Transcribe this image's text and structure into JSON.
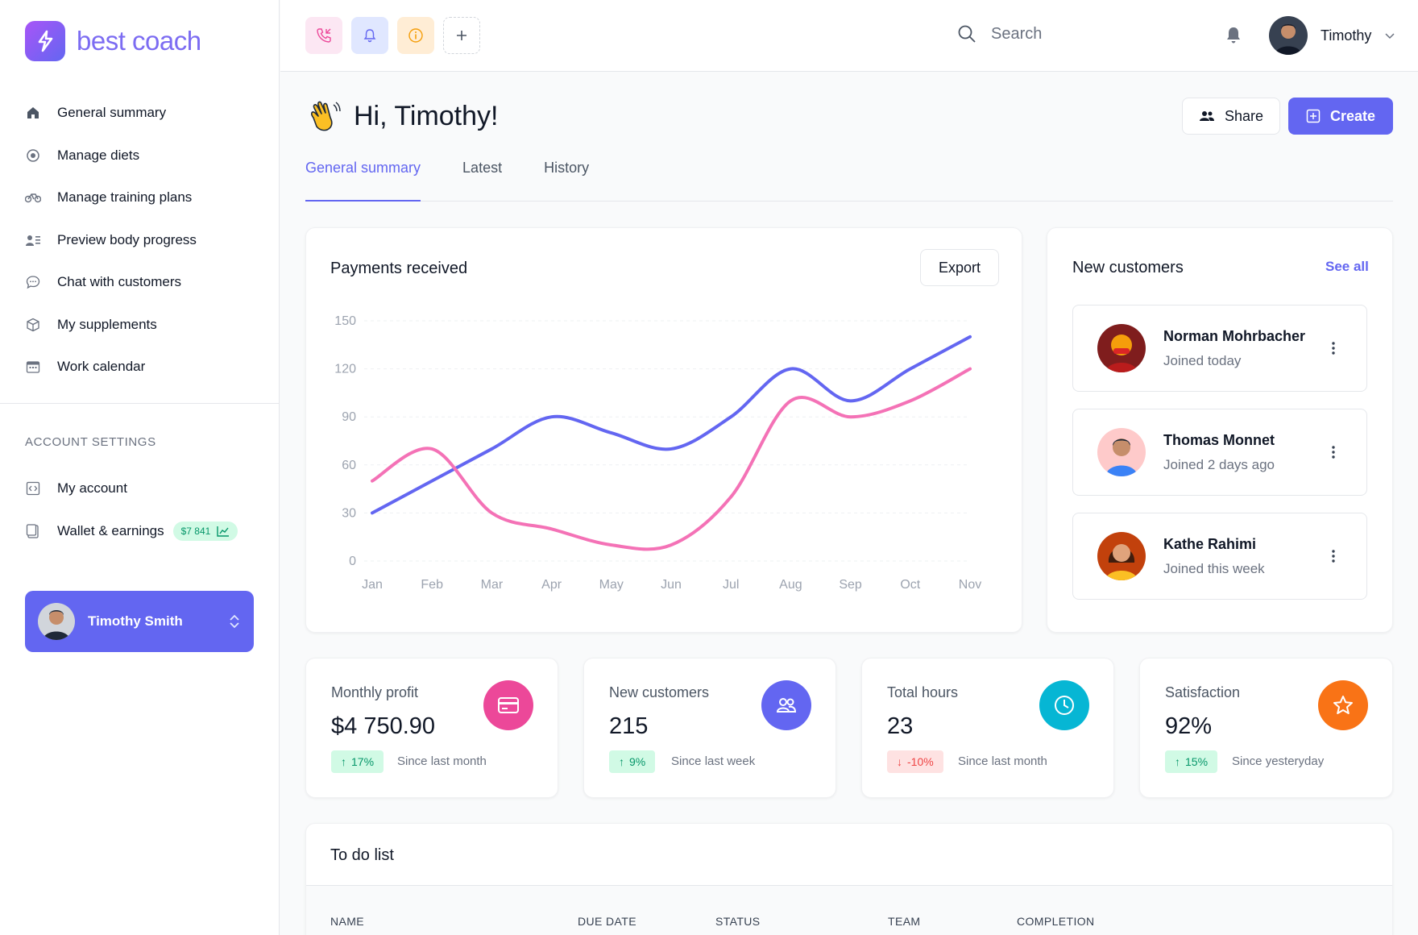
{
  "brand": {
    "name": "best coach"
  },
  "sidebar": {
    "items": [
      {
        "label": "General summary",
        "icon": "home-icon"
      },
      {
        "label": "Manage diets",
        "icon": "target-icon"
      },
      {
        "label": "Manage training plans",
        "icon": "bike-icon"
      },
      {
        "label": "Preview body progress",
        "icon": "user-list-icon"
      },
      {
        "label": "Chat with customers",
        "icon": "chat-icon"
      },
      {
        "label": "My supplements",
        "icon": "box-icon"
      },
      {
        "label": "Work calendar",
        "icon": "calendar-icon"
      }
    ],
    "account_section_title": "ACCOUNT SETTINGS",
    "account_items": [
      {
        "label": "My account",
        "icon": "code-icon"
      },
      {
        "label": "Wallet & earnings",
        "icon": "wallet-icon",
        "badge": "$7 841"
      }
    ],
    "user_card": {
      "name": "Timothy Smith"
    }
  },
  "topbar": {
    "search_placeholder": "Search",
    "user_name": "Timothy",
    "quick_buttons": [
      "phone-icon",
      "bell-icon",
      "info-icon",
      "plus-icon"
    ]
  },
  "main": {
    "greeting": "Hi, Timothy!",
    "share_label": "Share",
    "create_label": "Create",
    "tabs": [
      {
        "label": "General summary",
        "active": true
      },
      {
        "label": "Latest",
        "active": false
      },
      {
        "label": "History",
        "active": false
      }
    ]
  },
  "payments": {
    "title": "Payments received",
    "export_label": "Export"
  },
  "chart_data": {
    "type": "line",
    "title": "Payments received",
    "categories": [
      "Jan",
      "Feb",
      "Mar",
      "Apr",
      "May",
      "Jun",
      "Jul",
      "Aug",
      "Sep",
      "Oct",
      "Nov"
    ],
    "yticks": [
      0,
      30,
      60,
      90,
      120,
      150
    ],
    "ylim": [
      0,
      150
    ],
    "grid": true,
    "series": [
      {
        "color": "#6366f1",
        "values": [
          30,
          50,
          70,
          90,
          80,
          70,
          90,
          120,
          100,
          120,
          140
        ]
      },
      {
        "color": "#f472b6",
        "values": [
          50,
          70,
          30,
          20,
          10,
          10,
          40,
          100,
          90,
          100,
          120
        ]
      }
    ]
  },
  "new_customers": {
    "title": "New customers",
    "see_all": "See all",
    "items": [
      {
        "name": "Norman Mohrbacher",
        "joined": "Joined today"
      },
      {
        "name": "Thomas Monnet",
        "joined": "Joined 2 days ago"
      },
      {
        "name": "Kathe Rahimi",
        "joined": "Joined this week"
      }
    ]
  },
  "stats": [
    {
      "label": "Monthly profit",
      "value": "$4 750.90",
      "delta": "17%",
      "direction": "up",
      "since": "Since last month",
      "color": "#ec4899",
      "icon": "card-icon"
    },
    {
      "label": "New customers",
      "value": "215",
      "delta": "9%",
      "direction": "up",
      "since": "Since last week",
      "color": "#6366f1",
      "icon": "users-icon"
    },
    {
      "label": "Total hours",
      "value": "23",
      "delta": "-10%",
      "direction": "down",
      "since": "Since last month",
      "color": "#06b6d4",
      "icon": "clock-icon"
    },
    {
      "label": "Satisfaction",
      "value": "92%",
      "delta": "15%",
      "direction": "up",
      "since": "Since yesteryday",
      "color": "#f97316",
      "icon": "star-icon"
    }
  ],
  "todo": {
    "title": "To do list",
    "columns": [
      "NAME",
      "DUE DATE",
      "STATUS",
      "TEAM",
      "COMPLETION"
    ]
  }
}
